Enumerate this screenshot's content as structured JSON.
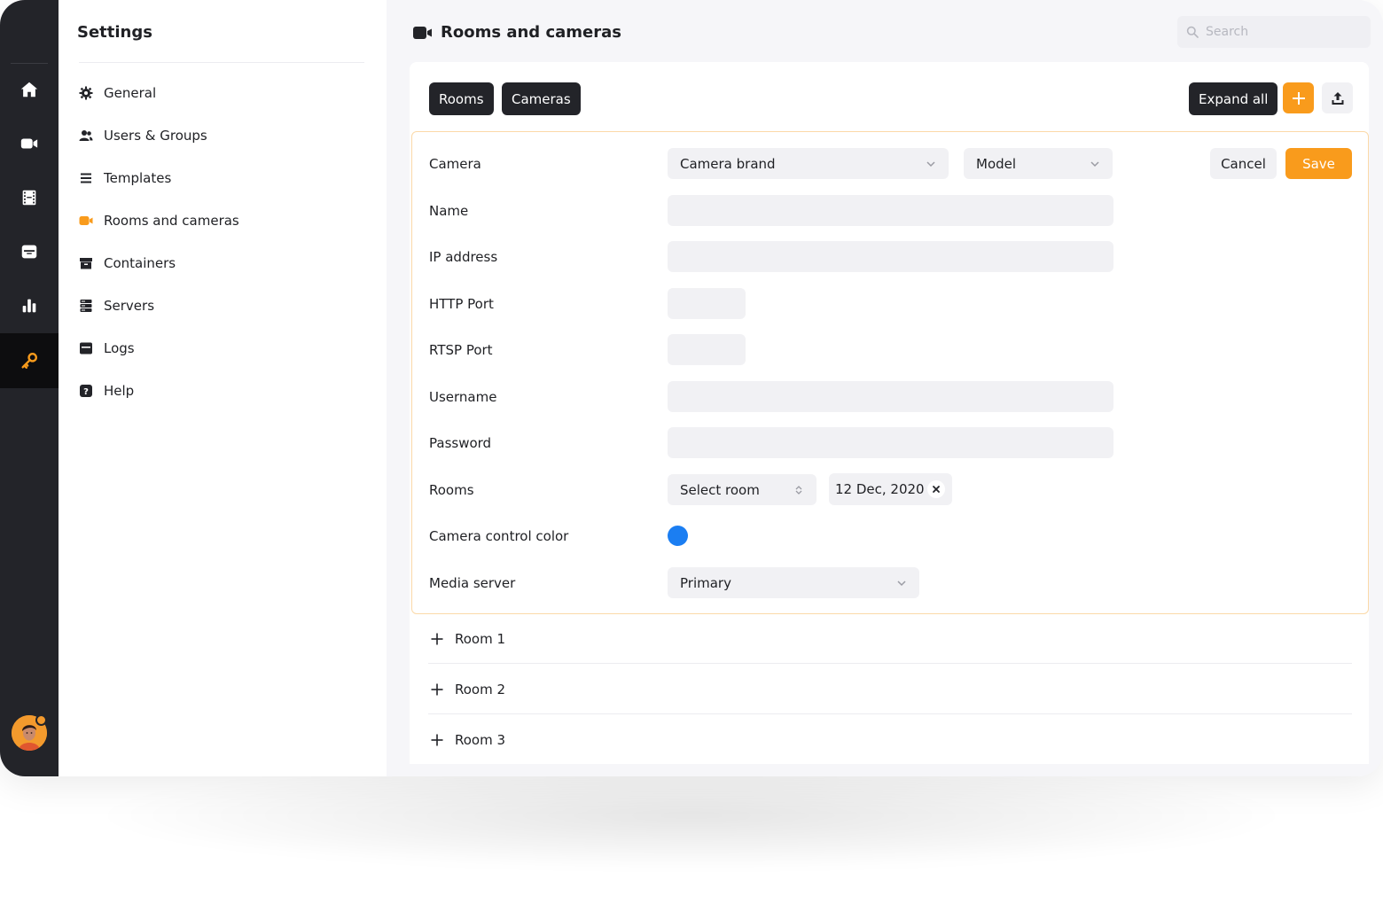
{
  "rail": {
    "items": [
      "home-icon",
      "video-camera-icon",
      "film-icon",
      "container-icon",
      "bar-chart-icon",
      "key-icon"
    ],
    "active": "key-icon"
  },
  "sidebar": {
    "title": "Settings",
    "items": [
      {
        "label": "General",
        "icon": "gear-icon"
      },
      {
        "label": "Users & Groups",
        "icon": "users-icon"
      },
      {
        "label": "Templates",
        "icon": "list-icon"
      },
      {
        "label": "Rooms and cameras",
        "icon": "video-camera-icon",
        "active": true
      },
      {
        "label": "Containers",
        "icon": "archive-icon"
      },
      {
        "label": "Servers",
        "icon": "server-icon"
      },
      {
        "label": "Logs",
        "icon": "log-icon"
      },
      {
        "label": "Help",
        "icon": "help-icon"
      }
    ]
  },
  "header": {
    "title": "Rooms and cameras",
    "search_placeholder": "Search"
  },
  "toolbar": {
    "tabs": [
      "Rooms",
      "Cameras"
    ],
    "expand_label": "Expand all"
  },
  "form": {
    "cancel_label": "Cancel",
    "save_label": "Save",
    "camera_label": "Camera",
    "brand_value": "Camera brand",
    "model_value": "Model",
    "name_label": "Name",
    "ip_label": "IP address",
    "http_label": "HTTP Port",
    "rtsp_label": "RTSP Port",
    "username_label": "Username",
    "password_label": "Password",
    "rooms_label": "Rooms",
    "room_select_value": "Select room",
    "room_tag": "12 Dec, 2020",
    "color_label": "Camera control color",
    "color_value": "#1b7ef2",
    "media_label": "Media server",
    "media_value": "Primary"
  },
  "rooms": [
    "Room 1",
    "Room 2",
    "Room 3"
  ],
  "colors": {
    "accent": "#f99b1c",
    "dark": "#232429"
  }
}
